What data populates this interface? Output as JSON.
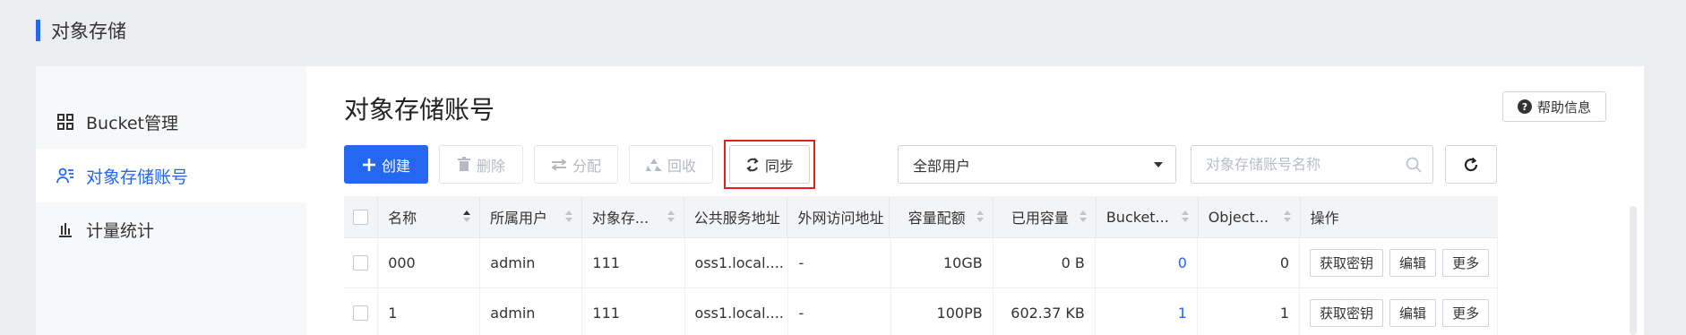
{
  "page": {
    "title": "对象存储"
  },
  "sidebar": {
    "items": [
      {
        "label": "Bucket管理",
        "icon": "grid-icon",
        "active": false
      },
      {
        "label": "对象存储账号",
        "icon": "user-list-icon",
        "active": true
      },
      {
        "label": "计量统计",
        "icon": "bar-chart-icon",
        "active": false
      }
    ]
  },
  "main": {
    "title": "对象存储账号",
    "help_label": "帮助信息",
    "toolbar": {
      "create": "创建",
      "delete": "删除",
      "assign": "分配",
      "recycle": "回收",
      "sync": "同步"
    },
    "filter": {
      "user_select": "全部用户",
      "search_placeholder": "对象存储账号名称"
    }
  },
  "table": {
    "columns": [
      "名称",
      "所属用户",
      "对象存...",
      "公共服务地址",
      "外网访问地址",
      "容量配额",
      "已用容量",
      "Bucket...",
      "Object...",
      "操作"
    ],
    "rows": [
      {
        "name": "000",
        "user": "admin",
        "store": "111",
        "public": "oss1.local....",
        "external": "-",
        "quota": "10GB",
        "used": "0 B",
        "bucket": "0",
        "object": "0"
      },
      {
        "name": "1",
        "user": "admin",
        "store": "111",
        "public": "oss1.local....",
        "external": "-",
        "quota": "100PB",
        "used": "602.37 KB",
        "bucket": "1",
        "object": "1"
      }
    ],
    "row_actions": {
      "get_key": "获取密钥",
      "edit": "编辑",
      "more": "更多"
    }
  },
  "colors": {
    "accent": "#2468f2",
    "highlight": "#e41e1e"
  }
}
